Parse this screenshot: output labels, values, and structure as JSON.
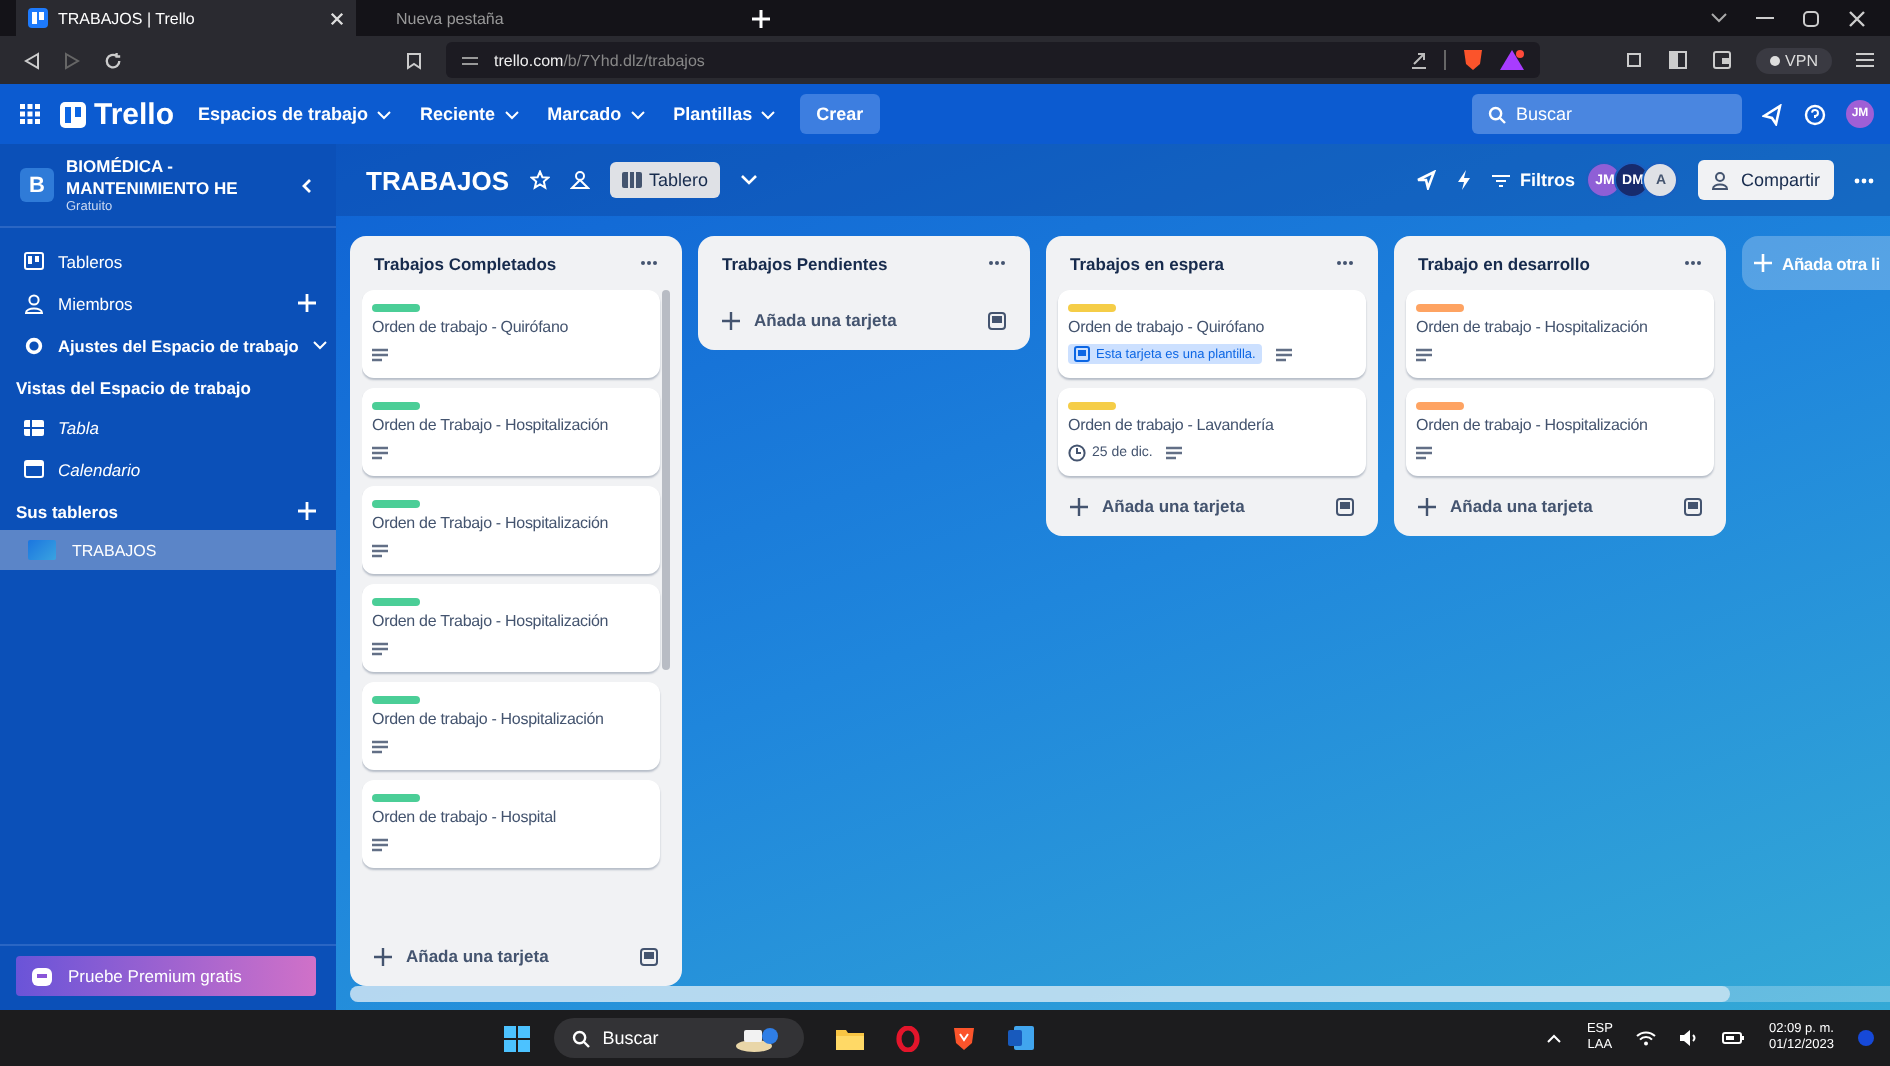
{
  "browser": {
    "tabs": [
      {
        "title": "TRABAJOS | Trello",
        "selected": true
      },
      {
        "title": "Nueva pestaña",
        "selected": false
      }
    ],
    "address": {
      "host": "trello.com",
      "path": "/b/7Yhd.dlz/trabajos"
    },
    "vpn": "VPN"
  },
  "header": {
    "logo": "Trello",
    "menus": [
      "Espacios de trabajo",
      "Reciente",
      "Marcado",
      "Plantillas"
    ],
    "create": "Crear",
    "search": {
      "placeholder": "Buscar"
    },
    "avatar": "JM"
  },
  "sidebar": {
    "workspace": {
      "initial": "B",
      "name": "BIOMÉDICA - MANTENIMIENTO HE",
      "plan": "Gratuito"
    },
    "items": [
      {
        "kind": "boards",
        "label": "Tableros"
      },
      {
        "kind": "members",
        "label": "Miembros"
      },
      {
        "kind": "settings",
        "label": "Ajustes del Espacio de trabajo"
      }
    ],
    "views_title": "Vistas del Espacio de trabajo",
    "views": [
      {
        "kind": "table",
        "label": "Tabla"
      },
      {
        "kind": "calendar",
        "label": "Calendario"
      }
    ],
    "boards_title": "Sus tableros",
    "boards": [
      {
        "label": "TRABAJOS",
        "selected": true
      }
    ],
    "premium": "Pruebe Premium gratis"
  },
  "board": {
    "title": "TRABAJOS",
    "view": "Tablero",
    "filter": "Filtros",
    "members": [
      "JM",
      "DM",
      "A"
    ],
    "share": "Compartir",
    "add_list": "Añada otra li",
    "lists": [
      {
        "title": "Trabajos Completados",
        "add_card": "Añada una tarjeta",
        "cards": [
          {
            "color": "#4bce97",
            "title": "Orden de trabajo - Quirófano",
            "badges": [
              {
                "kind": "description"
              }
            ]
          },
          {
            "color": "#4bce97",
            "title": "Orden de Trabajo - Hospitalización",
            "badges": [
              {
                "kind": "description"
              }
            ]
          },
          {
            "color": "#4bce97",
            "title": "Orden de Trabajo - Hospitalización",
            "badges": [
              {
                "kind": "description"
              }
            ]
          },
          {
            "color": "#4bce97",
            "title": "Orden de Trabajo - Hospitalización",
            "badges": [
              {
                "kind": "description"
              }
            ]
          },
          {
            "color": "#4bce97",
            "title": "Orden de trabajo - Hospitalización",
            "badges": [
              {
                "kind": "description"
              }
            ]
          },
          {
            "color": "#4bce97",
            "title": "Orden de trabajo - Hospital",
            "badges": [
              {
                "kind": "description"
              }
            ]
          }
        ]
      },
      {
        "title": "Trabajos Pendientes",
        "add_card": "Añada una tarjeta"
      },
      {
        "title": "Trabajos en espera",
        "add_card": "Añada una tarjeta",
        "cards": [
          {
            "color": "#f5cd47",
            "title": "Orden de trabajo - Quirófano",
            "badges": [
              {
                "kind": "template",
                "text": "Esta tarjeta es una plantilla."
              },
              {
                "kind": "description"
              }
            ]
          },
          {
            "color": "#f5cd47",
            "title": "Orden de trabajo - Lavandería",
            "badges": [
              {
                "kind": "due",
                "text": "25 de dic."
              },
              {
                "kind": "description"
              }
            ]
          }
        ]
      },
      {
        "title": "Trabajo en desarrollo",
        "add_card": "Añada una tarjeta",
        "cards": [
          {
            "color": "#fea362",
            "title": "Orden de trabajo - Hospitalización",
            "badges": [
              {
                "kind": "description"
              }
            ]
          },
          {
            "color": "#fea362",
            "title": "Orden de trabajo - Hospitalización",
            "badges": [
              {
                "kind": "description"
              }
            ]
          }
        ]
      }
    ]
  },
  "taskbar": {
    "search": {
      "placeholder": "Buscar"
    },
    "language": "ESP",
    "layout": "LAA",
    "time": "02:09 p. m.",
    "date": "01/12/2023"
  }
}
